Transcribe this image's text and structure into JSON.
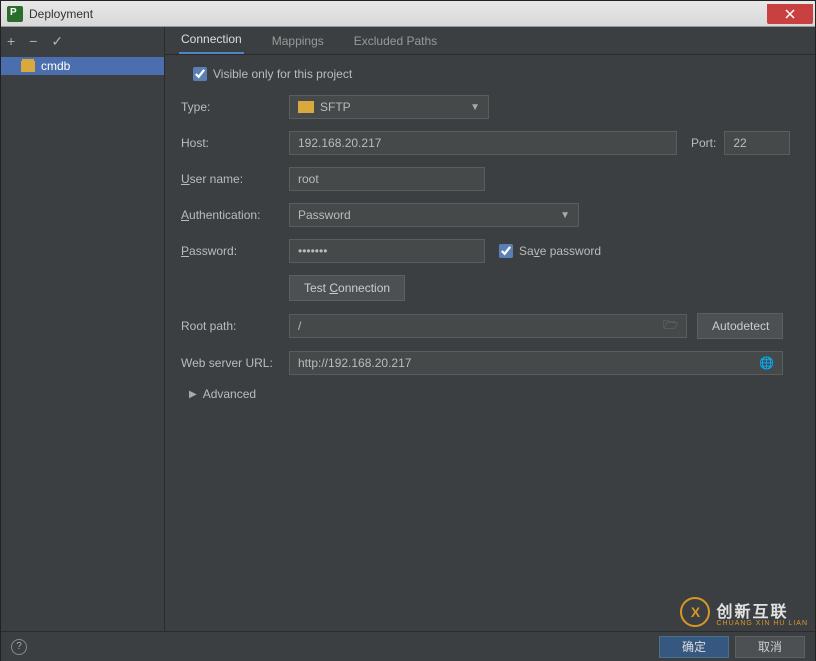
{
  "window": {
    "title": "Deployment",
    "close": "×"
  },
  "toolbar": {
    "add": "+",
    "remove": "−",
    "check": "✓"
  },
  "tree": {
    "item0": "cmdb"
  },
  "tabs": {
    "connection": "Connection",
    "mappings": "Mappings",
    "excluded": "Excluded Paths"
  },
  "form": {
    "visible_label": "Visible only for this project",
    "visible_checked": true,
    "type_label": "Type:",
    "type_value": "SFTP",
    "host_label": "Host:",
    "host_value": "192.168.20.217",
    "port_label": "Port:",
    "port_value": "22",
    "user_label": "User name:",
    "user_underline": "U",
    "user_value": "root",
    "auth_label": "Authentication:",
    "auth_underline": "A",
    "auth_value": "Password",
    "pass_label": "Password:",
    "pass_underline": "P",
    "pass_value": "•••••••",
    "save_pass_label": "Save password",
    "save_pass_underline": "v",
    "save_pass_checked": true,
    "test_btn": "Test Connection",
    "test_underline": "C",
    "root_label": "Root path:",
    "root_value": "/",
    "autodetect": "Autodetect",
    "url_label": "Web server URL:",
    "url_value": "http://192.168.20.217",
    "advanced": "Advanced"
  },
  "buttons": {
    "ok": "确定",
    "cancel": "取消",
    "help": "?"
  },
  "watermark": {
    "logo": "X",
    "main": "创新互联",
    "sub": "CHUANG XIN HU LIAN"
  }
}
